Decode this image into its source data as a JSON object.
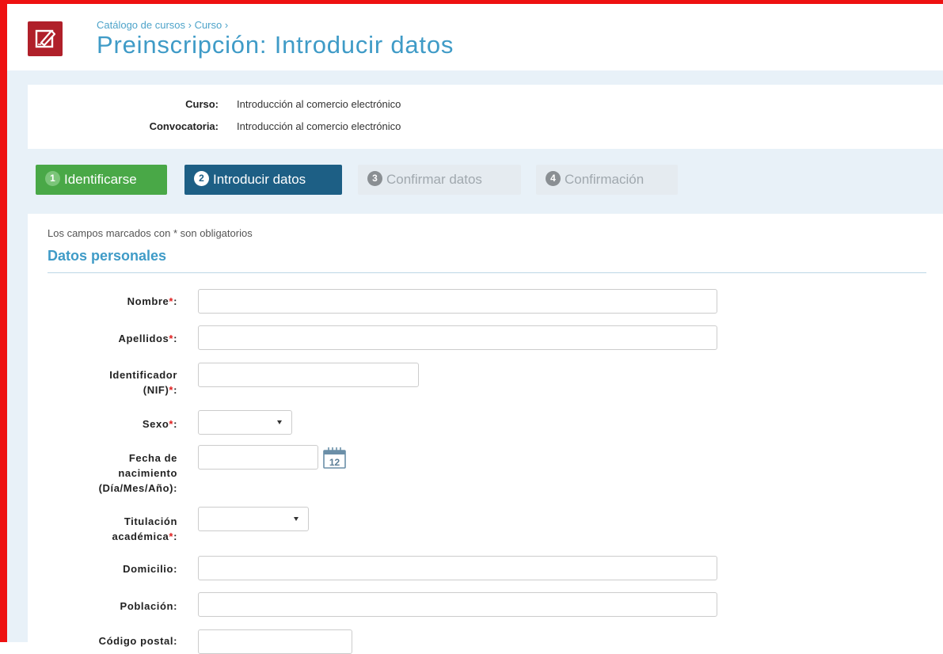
{
  "header": {
    "breadcrumb": "Catálogo de cursos › Curso ›",
    "title": "Preinscripción: Introducir datos",
    "logo_icon": "edit-document-icon"
  },
  "info": {
    "curso_label": "Curso:",
    "curso_value": "Introducción al comercio electrónico",
    "convocatoria_label": "Convocatoria:",
    "convocatoria_value": "Introducción al comercio electrónico"
  },
  "steps": [
    {
      "num": "1",
      "label": "Identificarse",
      "state": "completed"
    },
    {
      "num": "2",
      "label": "Introducir datos",
      "state": "current"
    },
    {
      "num": "3",
      "label": "Confirmar datos",
      "state": "pending"
    },
    {
      "num": "4",
      "label": "Confirmación",
      "state": "pending"
    }
  ],
  "form": {
    "required_note": "Los campos marcados con * son obligatorios",
    "section_title": "Datos personales",
    "required_mark": "*",
    "fields": {
      "nombre": {
        "label": "Nombre",
        "value": ""
      },
      "apellidos": {
        "label": "Apellidos",
        "value": ""
      },
      "nif": {
        "label_line1": "Identificador",
        "label_line2": "(NIF)",
        "value": ""
      },
      "sexo": {
        "label": "Sexo",
        "selected": ""
      },
      "fecha": {
        "label_line1": "Fecha de",
        "label_line2": "nacimiento",
        "label_line3": "(Día/Mes/Año):",
        "value": "",
        "calendar_icon": "calendar-icon",
        "calendar_day": "12"
      },
      "titulacion": {
        "label_line1": "Titulación",
        "label_line2": "académica",
        "selected": ""
      },
      "domicilio": {
        "label": "Domicilio:",
        "value": ""
      },
      "poblacion": {
        "label": "Población:",
        "value": ""
      },
      "codigo_postal": {
        "label": "Código postal:",
        "value": ""
      }
    }
  },
  "colors": {
    "frame": "#ee1111",
    "accent": "#3f9bc7",
    "step_done": "#49a847",
    "step_current": "#1d5f85",
    "logo_bg": "#b0202a",
    "required": "#e02020"
  }
}
